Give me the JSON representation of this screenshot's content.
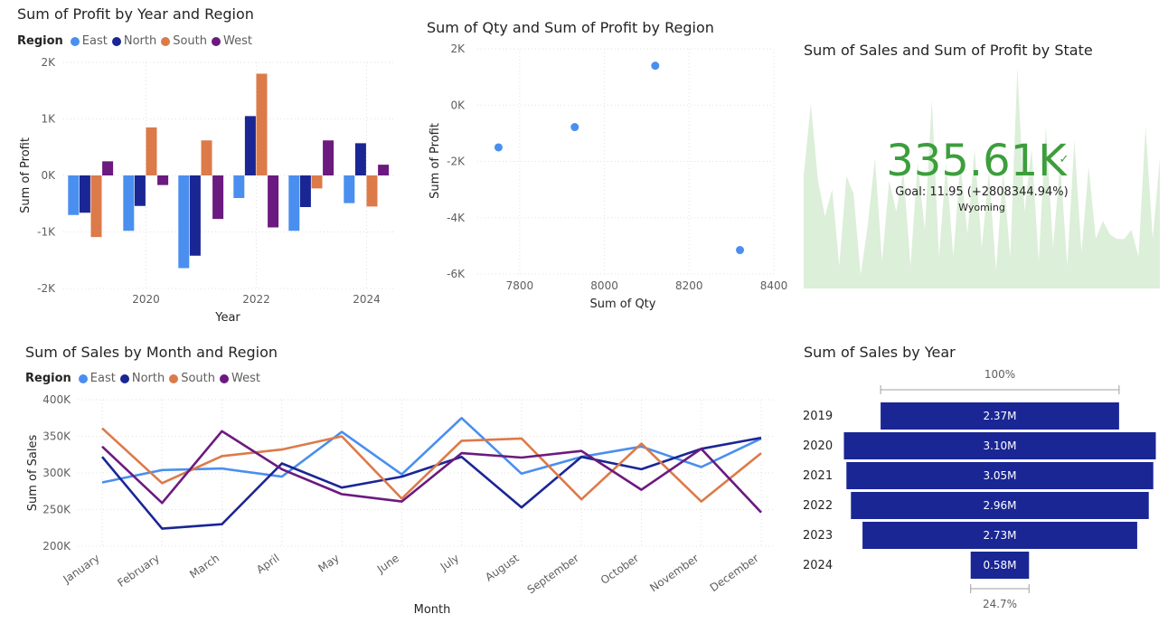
{
  "chart_data": [
    {
      "id": "profit_year_region",
      "type": "bar",
      "title": "Sum of Profit by Year and Region",
      "legend_label": "Region",
      "xlabel": "Year",
      "ylabel": "Sum of Profit",
      "categories": [
        2019,
        2020,
        2021,
        2022,
        2023,
        2024
      ],
      "x_tick_labels": [
        "2020",
        "2022",
        "2024"
      ],
      "x_tick_values": [
        2020,
        2022,
        2024
      ],
      "y_ticks": [
        -2000,
        -1000,
        0,
        1000,
        2000
      ],
      "y_tick_labels": [
        "-2K",
        "-1K",
        "0K",
        "1K",
        "2K"
      ],
      "ylim": [
        -2000,
        2000
      ],
      "series": [
        {
          "name": "East",
          "color": "#4a8fef",
          "values": [
            -700,
            -980,
            -1640,
            -400,
            -980,
            -490
          ]
        },
        {
          "name": "North",
          "color": "#1a2694",
          "values": [
            -660,
            -540,
            -1420,
            1050,
            -560,
            570
          ]
        },
        {
          "name": "South",
          "color": "#dc7a4a",
          "values": [
            -1090,
            850,
            620,
            1800,
            -230,
            -550
          ]
        },
        {
          "name": "West",
          "color": "#6b1a7f",
          "values": [
            250,
            -170,
            -770,
            -920,
            620,
            190
          ]
        }
      ]
    },
    {
      "id": "qty_profit_region",
      "type": "scatter",
      "title": "Sum of Qty and Sum of Profit by Region",
      "xlabel": "Sum of Qty",
      "ylabel": "Sum of Profit",
      "color": "#4a8fef",
      "x_ticks": [
        7800,
        8000,
        8200,
        8400
      ],
      "x_tick_labels": [
        "7800",
        "8000",
        "8200",
        "8400"
      ],
      "y_ticks": [
        2000,
        0,
        -2000,
        -4000,
        -6000
      ],
      "y_tick_labels": [
        "2K",
        "0K",
        "-2K",
        "-4K",
        "-6K"
      ],
      "xlim": [
        7700,
        8400
      ],
      "ylim": [
        -6000,
        2000
      ],
      "points": [
        {
          "x": 7750,
          "y": -1500
        },
        {
          "x": 7930,
          "y": -780
        },
        {
          "x": 8120,
          "y": 1400
        },
        {
          "x": 8320,
          "y": -5150
        }
      ]
    },
    {
      "id": "sales_month_region",
      "type": "line",
      "title": "Sum of Sales by Month and Region",
      "legend_label": "Region",
      "xlabel": "Month",
      "ylabel": "Sum of Sales",
      "categories": [
        "January",
        "February",
        "March",
        "April",
        "May",
        "June",
        "July",
        "August",
        "September",
        "October",
        "November",
        "December"
      ],
      "y_ticks": [
        200000,
        250000,
        300000,
        350000,
        400000
      ],
      "y_tick_labels": [
        "200K",
        "250K",
        "300K",
        "350K",
        "400K"
      ],
      "ylim": [
        200000,
        400000
      ],
      "series": [
        {
          "name": "East",
          "color": "#4a8fef",
          "values": [
            287000,
            304000,
            306000,
            295000,
            356000,
            298000,
            375000,
            299000,
            322000,
            336000,
            308000,
            347000
          ]
        },
        {
          "name": "North",
          "color": "#1a2694",
          "values": [
            322000,
            224000,
            230000,
            313000,
            280000,
            295000,
            322000,
            253000,
            322000,
            305000,
            333000,
            348000
          ]
        },
        {
          "name": "South",
          "color": "#dc7a4a",
          "values": [
            361000,
            286000,
            323000,
            332000,
            350000,
            265000,
            344000,
            347000,
            264000,
            340000,
            261000,
            327000
          ]
        },
        {
          "name": "West",
          "color": "#6b1a7f",
          "values": [
            336000,
            259000,
            357000,
            305000,
            271000,
            261000,
            327000,
            321000,
            330000,
            277000,
            333000,
            246000
          ]
        }
      ]
    },
    {
      "id": "sales_profit_state_kpi",
      "type": "area",
      "title": "Sum of Sales and Sum of Profit by State",
      "kpi_value": "335.61K",
      "kpi_check": "✓",
      "goal_text": "Goal: 11.95 (+2808344.94%)",
      "state": "Wyoming",
      "area_color": "#dcefd9",
      "kpi_color": "#3c9e3c",
      "values": [
        0.5,
        0.82,
        0.48,
        0.32,
        0.44,
        0.1,
        0.5,
        0.42,
        0.06,
        0.28,
        0.58,
        0.12,
        0.48,
        0.34,
        0.52,
        0.1,
        0.56,
        0.26,
        0.84,
        0.14,
        0.56,
        0.14,
        0.56,
        0.24,
        0.62,
        0.18,
        0.52,
        0.08,
        0.52,
        0.14,
        0.98,
        0.34,
        0.62,
        0.12,
        0.72,
        0.18,
        0.56,
        0.1,
        0.66,
        0.16,
        0.54,
        0.22,
        0.3,
        0.24,
        0.22,
        0.22,
        0.26,
        0.14,
        0.72,
        0.22,
        0.58
      ]
    },
    {
      "id": "sales_by_year_funnel",
      "type": "bar",
      "title": "Sum of Sales by Year",
      "color": "#1a2694",
      "top_percent": "100%",
      "bottom_percent": "24.7%",
      "categories": [
        "2019",
        "2020",
        "2021",
        "2022",
        "2023",
        "2024"
      ],
      "values": [
        2.37,
        3.1,
        3.05,
        2.96,
        2.73,
        0.58
      ],
      "value_labels": [
        "2.37M",
        "3.10M",
        "3.05M",
        "2.96M",
        "2.73M",
        "0.58M"
      ]
    }
  ]
}
